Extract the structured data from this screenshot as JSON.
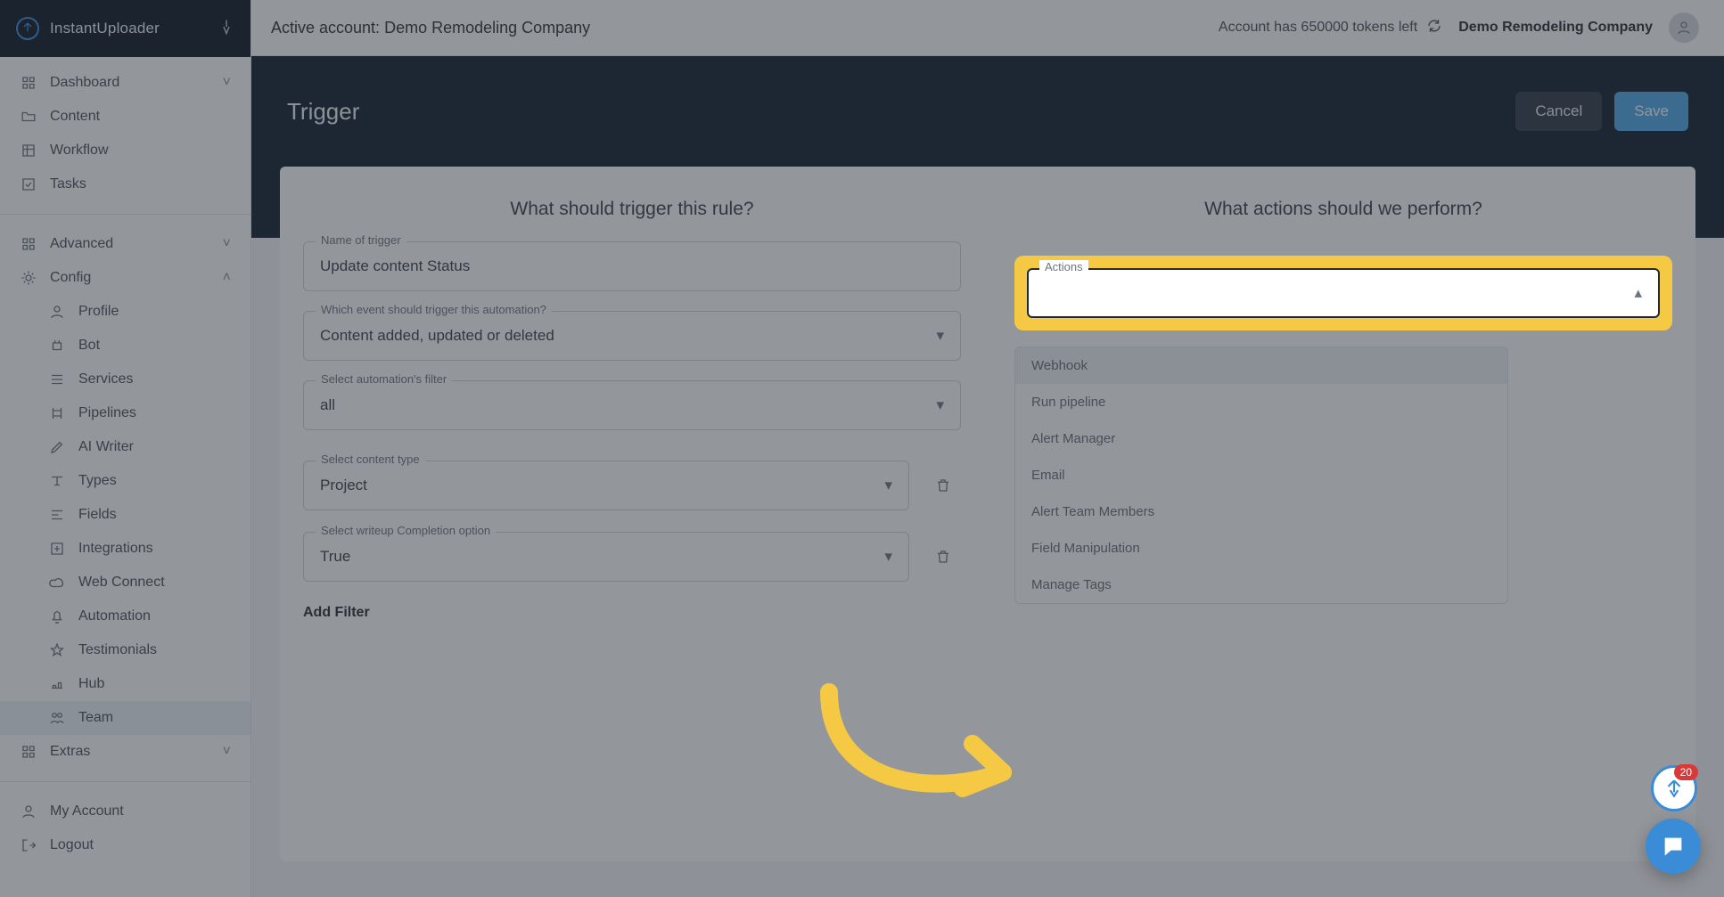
{
  "brand": {
    "name": "InstantUploader"
  },
  "sidebar": {
    "top": [
      {
        "label": "Dashboard",
        "icon": "grid",
        "expandable": true
      },
      {
        "label": "Content",
        "icon": "folder"
      },
      {
        "label": "Workflow",
        "icon": "board"
      },
      {
        "label": "Tasks",
        "icon": "check-square"
      }
    ],
    "groups": [
      {
        "label": "Advanced",
        "icon": "modules",
        "expandable": true,
        "open": false
      },
      {
        "label": "Config",
        "icon": "gear",
        "expandable": true,
        "open": true,
        "items": [
          {
            "label": "Profile",
            "icon": "user"
          },
          {
            "label": "Bot",
            "icon": "robot"
          },
          {
            "label": "Services",
            "icon": "stack"
          },
          {
            "label": "Pipelines",
            "icon": "pipeline"
          },
          {
            "label": "AI Writer",
            "icon": "pen"
          },
          {
            "label": "Types",
            "icon": "type"
          },
          {
            "label": "Fields",
            "icon": "fields"
          },
          {
            "label": "Integrations",
            "icon": "plus-square"
          },
          {
            "label": "Web Connect",
            "icon": "cloud"
          },
          {
            "label": "Automation",
            "icon": "bell"
          },
          {
            "label": "Testimonials",
            "icon": "star"
          },
          {
            "label": "Hub",
            "icon": "hub"
          },
          {
            "label": "Team",
            "icon": "team",
            "selected": true
          }
        ]
      },
      {
        "label": "Extras",
        "icon": "modules",
        "expandable": true,
        "open": false
      }
    ],
    "bottom": [
      {
        "label": "My Account",
        "icon": "user"
      },
      {
        "label": "Logout",
        "icon": "logout"
      }
    ]
  },
  "topbar": {
    "active_account_prefix": "Active account: ",
    "active_account_name": "Demo Remodeling Company",
    "tokens_text": "Account has 650000 tokens left",
    "company": "Demo Remodeling Company"
  },
  "page": {
    "title": "Trigger",
    "cancel": "Cancel",
    "save": "Save",
    "left_title": "What should trigger this rule?",
    "right_title": "What actions should we perform?",
    "fields": {
      "name": {
        "label": "Name of trigger",
        "value": "Update content Status"
      },
      "event": {
        "label": "Which event should trigger this automation?",
        "value": "Content added, updated or deleted"
      },
      "filter": {
        "label": "Select automation's filter",
        "value": "all"
      },
      "ctype": {
        "label": "Select content type",
        "value": "Project"
      },
      "writeup": {
        "label": "Select writeup Completion option",
        "value": "True"
      }
    },
    "add_filter": "Add Filter",
    "actions_label": "Actions",
    "actions_menu": [
      {
        "label": "Webhook"
      },
      {
        "label": "Run pipeline"
      },
      {
        "label": "Alert Manager"
      },
      {
        "label": "Email"
      },
      {
        "label": "Alert Team Members"
      },
      {
        "label": "Field Manipulation"
      },
      {
        "label": "Manage Tags"
      }
    ]
  },
  "chat": {
    "badge": "20"
  }
}
